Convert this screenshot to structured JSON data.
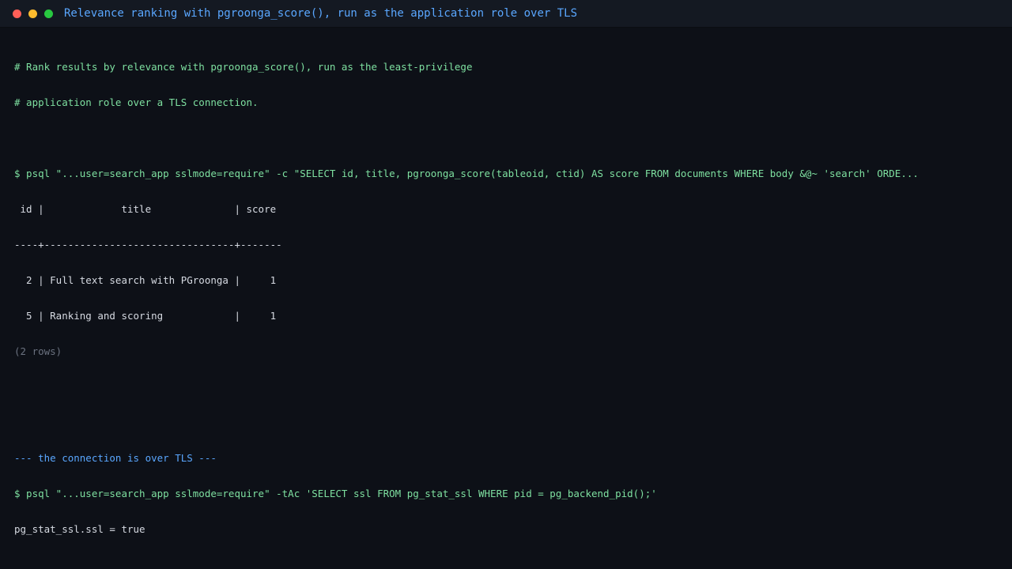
{
  "window": {
    "title": "Relevance ranking with pgroonga_score(), run as the application role over TLS"
  },
  "terminal": {
    "comment_1": "# Rank results by relevance with pgroonga_score(), run as the least-privilege",
    "comment_2": "# application role over a TLS connection.",
    "command_1": "$ psql \"...user=search_app sslmode=require\" -c \"SELECT id, title, pgroonga_score(tableoid, ctid) AS score FROM documents WHERE body &@~ 'search' ORDE...",
    "table": {
      "header": " id |             title              | score",
      "separator": "----+--------------------------------+-------",
      "rows": [
        "  2 | Full text search with PGroonga |     1",
        "  5 | Ranking and scoring            |     1"
      ],
      "footer": "(2 rows)"
    },
    "section_label": "--- the connection is over TLS ---",
    "command_2": "$ psql \"...user=search_app sslmode=require\" -tAc 'SELECT ssl FROM pg_stat_ssl WHERE pid = pg_backend_pid();'",
    "result_2": "pg_stat_ssl.ssl = true"
  }
}
